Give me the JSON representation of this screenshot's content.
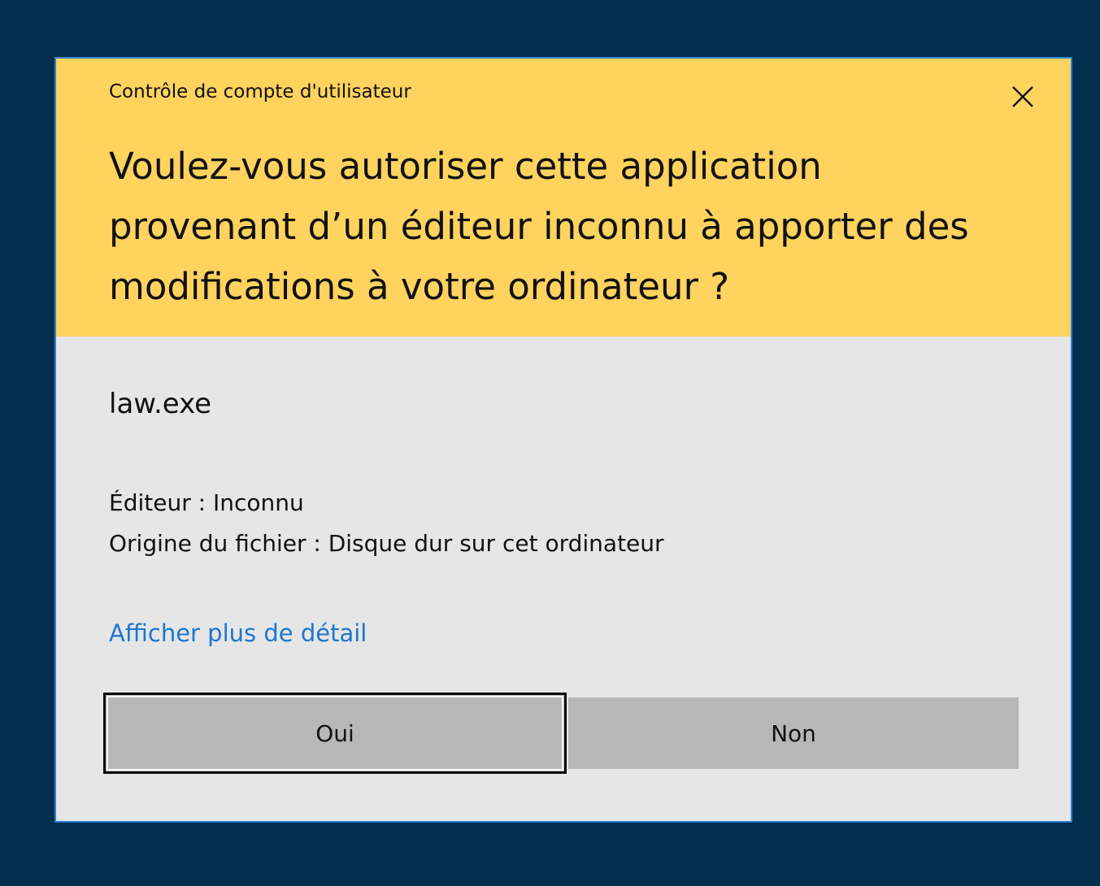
{
  "dialog": {
    "title": "Contrôle de compte d'utilisateur",
    "close_icon": "close-icon",
    "question": "Voulez-vous autoriser cette application provenant d’un éditeur inconnu à apporter des modifications à votre ordinateur ?",
    "app_name": "law.exe",
    "publisher": "Éditeur : Inconnu",
    "origin": "Origine du fichier : Disque dur sur cet ordinateur",
    "details_link": "Afficher plus de détail",
    "buttons": {
      "yes": "Oui",
      "no": "Non"
    }
  },
  "colors": {
    "desktop_background": "#03304d",
    "header_background": "#ffd35e",
    "body_background": "#e6e6e6",
    "dialog_border": "#2f7fd0",
    "link": "#1c76cf",
    "button": "#b7b7b7"
  }
}
